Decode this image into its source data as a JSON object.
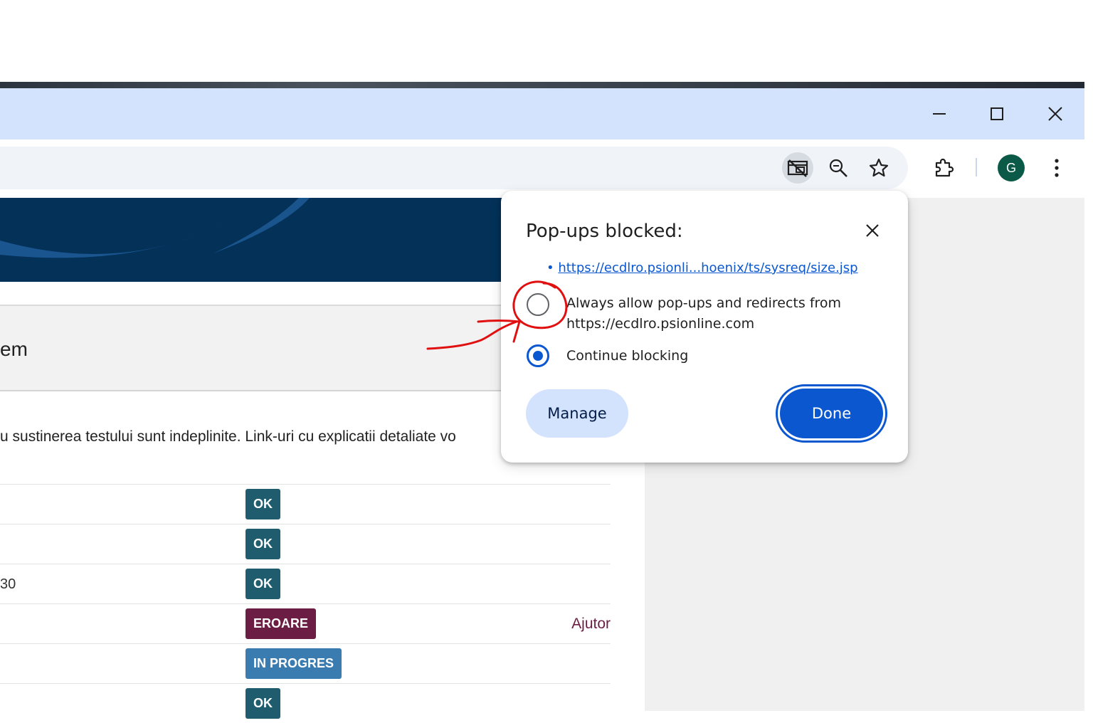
{
  "window": {
    "minimize_icon": "minimize-icon",
    "maximize_icon": "maximize-icon",
    "close_icon": "close-icon"
  },
  "toolbar": {
    "popup_blocked_icon": "popup-blocked-icon",
    "zoom_icon": "zoom-icon",
    "bookmark_icon": "star-icon",
    "extensions_icon": "puzzle-icon",
    "profile_initial": "G",
    "menu_icon": "three-dots-icon"
  },
  "page": {
    "section_title": "em",
    "intro_text": "u sustinerea testului sunt indeplinite. Link-uri cu explicatii detaliate vo",
    "rows": [
      {
        "left": "",
        "status": "OK",
        "color": "#1f5c6e",
        "help": ""
      },
      {
        "left": "",
        "status": "OK",
        "color": "#1f5c6e",
        "help": ""
      },
      {
        "left": "30",
        "status": "OK",
        "color": "#1f5c6e",
        "help": ""
      },
      {
        "left": "",
        "status": "EROARE",
        "color": "#6b1d44",
        "help": "Ajutor"
      },
      {
        "left": "",
        "status": "IN PROGRES",
        "color": "#3a7bb0",
        "help": ""
      },
      {
        "left": "",
        "status": "OK",
        "color": "#1f5c6e",
        "help": ""
      }
    ]
  },
  "popup_bubble": {
    "title": "Pop-ups blocked:",
    "blocked_link": "https://ecdlro.psionli...hoenix/ts/sysreq/size.jsp",
    "option_allow_line1": "Always allow pop-ups and redirects from",
    "option_allow_line2": "https://ecdlro.psionline.com",
    "option_block": "Continue blocking",
    "selected": "continue-blocking",
    "manage_label": "Manage",
    "done_label": "Done"
  },
  "colors": {
    "accent": "#0b57d0",
    "titlebar": "#d3e3fd",
    "banner": "#033158",
    "annotation": "#e01010"
  }
}
